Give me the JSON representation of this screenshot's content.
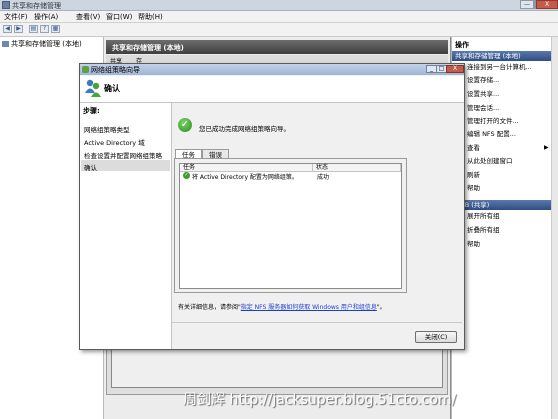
{
  "main_window": {
    "title": "共享和存储管理",
    "buttons": {
      "minimize": "—",
      "maximize": "□",
      "close": "X"
    }
  },
  "menu": [
    "文件(F)",
    "操作(A)",
    "查看(V)",
    "窗口(W)",
    "帮助(H)"
  ],
  "tree": {
    "root": "共享和存储管理 (本地)"
  },
  "center": {
    "header": "共享和存储管理 (本地)",
    "tabs": [
      "共享",
      "存"
    ]
  },
  "actions": {
    "header": "操作",
    "section1": "共享和存储管理 (本地)",
    "items1": [
      "连接到另一台计算机...",
      "设置存储...",
      "设置共享...",
      "管理会话...",
      "管理打开的文件...",
      "编辑 NFS 配置...",
      "查看",
      "从此处创建窗口",
      "刷新",
      "帮助"
    ],
    "section2": "SMB (共享)",
    "items2": [
      "展开所有组",
      "折叠所有组",
      "帮助"
    ]
  },
  "dialog": {
    "title": "网络组策略向导",
    "banner_title": "确认",
    "steps_header": "步骤:",
    "steps": [
      "网络组策略类型",
      "Active Directory 域",
      "检查设置并配置网络组策略",
      "确认"
    ],
    "success_message": "您已成功完成网络组策略向导。",
    "tabs": [
      "任务",
      "错误"
    ],
    "columns": [
      "任务",
      "状态"
    ],
    "rows": [
      {
        "task": "将 Active Directory 配置为网络组策。",
        "status": "成功"
      }
    ],
    "more_info_prefix": "有关详细信息，请参阅\"",
    "more_info_link": "指定 NFS 服务器如何获取 Windows 用户和组信息",
    "more_info_suffix": "\"。",
    "close_label": "关闭(C)"
  },
  "watermark": "周剑辉 http://jacksuper.blog.51cto.com/"
}
